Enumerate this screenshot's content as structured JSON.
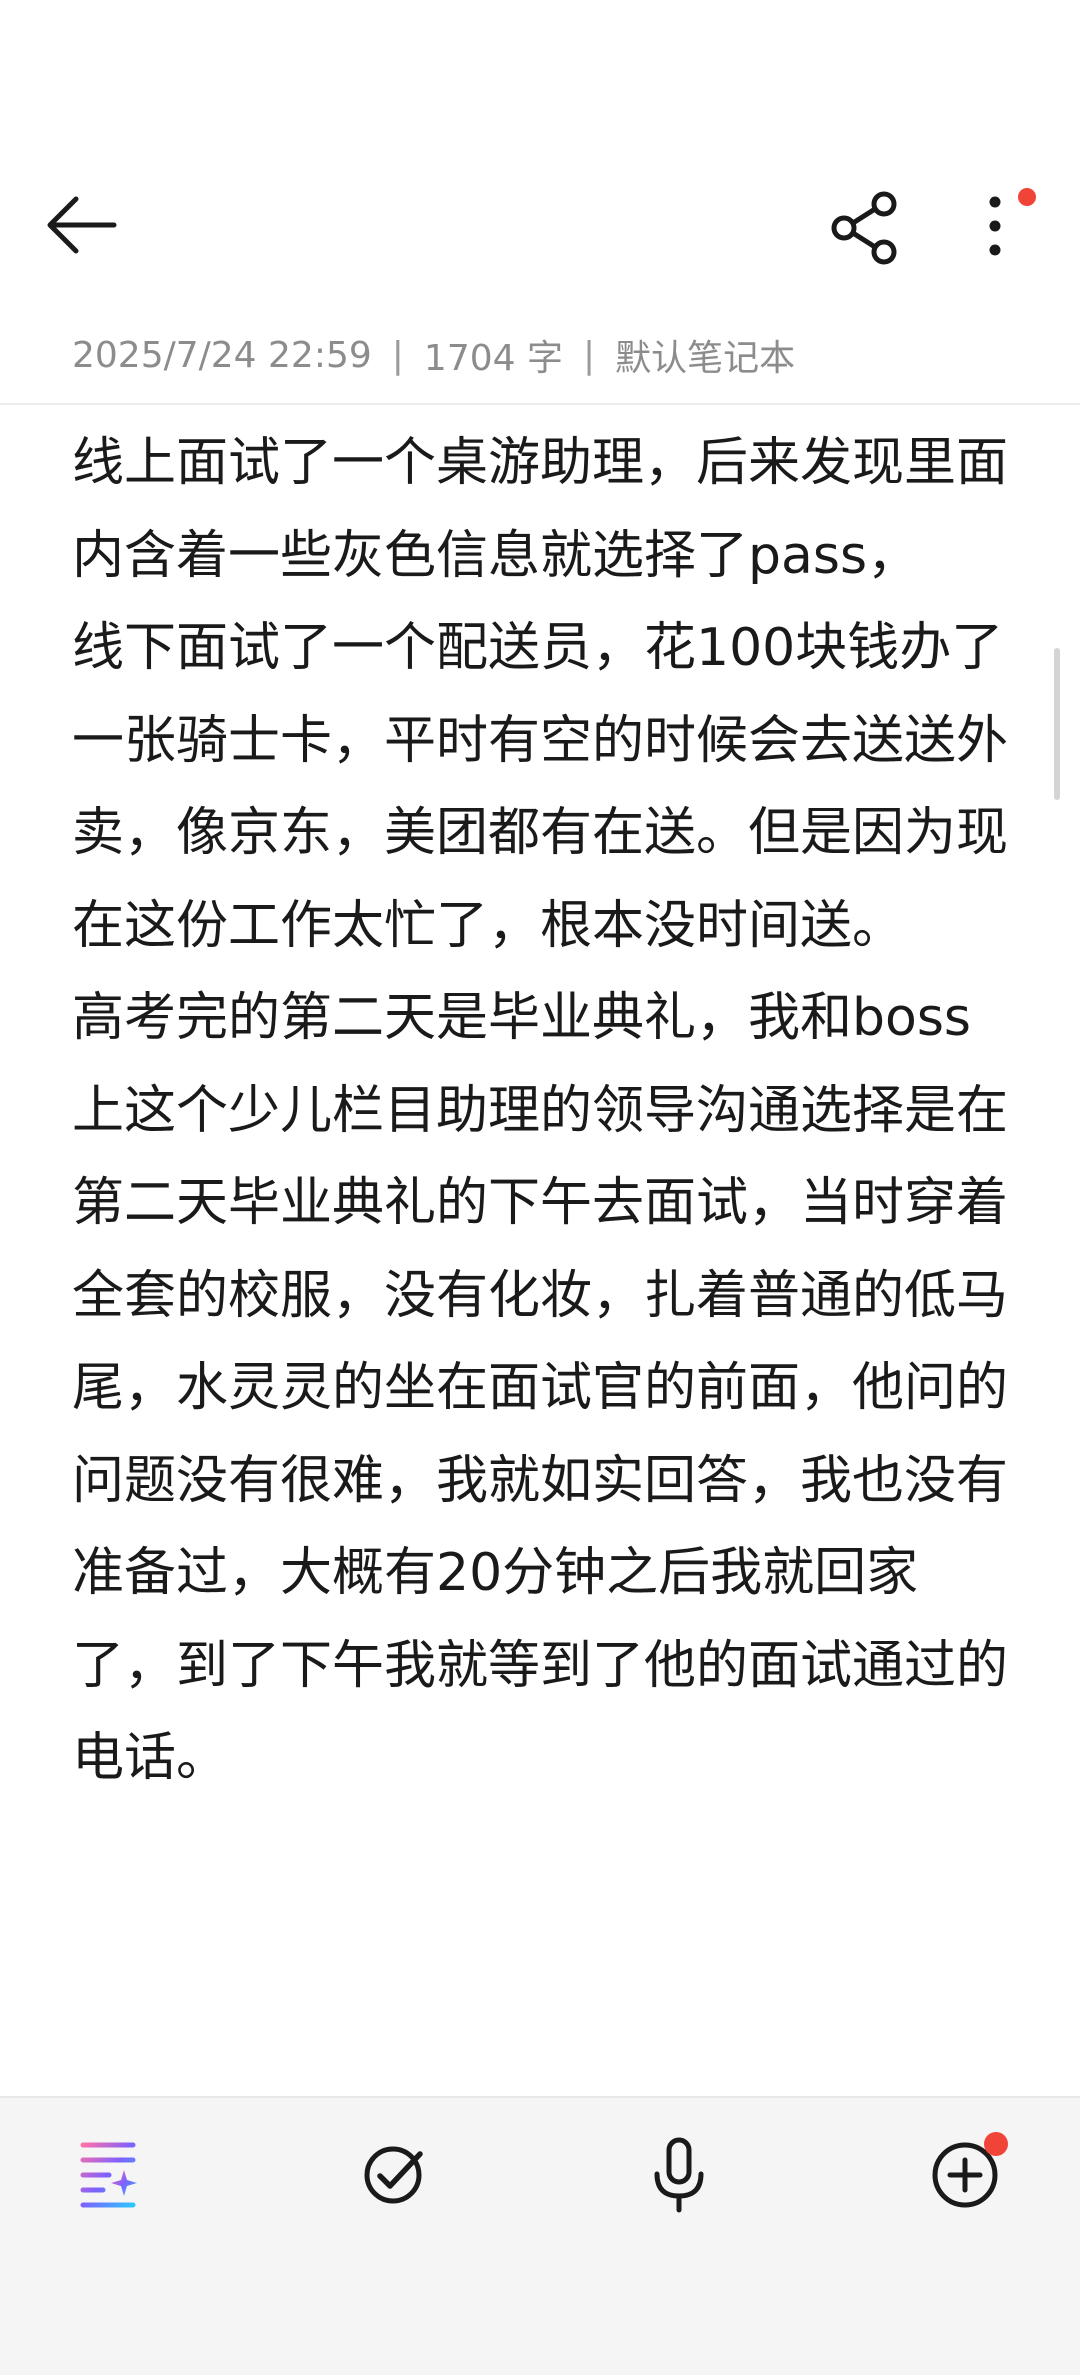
{
  "toolbar": {
    "back_icon": "arrow-left-icon",
    "share_icon": "share-icon",
    "more_icon": "more-vertical-icon",
    "notification_dot_color": "#f04438"
  },
  "meta": {
    "datetime": "2025/7/24 22:59",
    "separator": "|",
    "word_count": "1704 字",
    "notebook": "默认笔记本"
  },
  "note": {
    "content": "线上面试了一个桌游助理，后来发现里面内含着一些灰色信息就选择了pass，\n线下面试了一个配送员，花100块钱办了一张骑士卡，平时有空的时候会去送送外卖，像京东，美团都有在送。但是因为现在这份工作太忙了，根本没时间送。\n高考完的第二天是毕业典礼，我和boss上这个少儿栏目助理的领导沟通选择是在第二天毕业典礼的下午去面试，当时穿着全套的校服，没有化妆，扎着普通的低马尾，水灵灵的坐在面试官的前面，他问的问题没有很难，我就如实回答，我也没有准备过，大概有20分钟之后我就回家了，到了下午我就等到了他的面试通过的电话。"
  },
  "bottom_tools": {
    "ai_icon": "ai-format-icon",
    "todo_icon": "checklist-icon",
    "voice_icon": "microphone-icon",
    "add_icon": "add-circle-icon",
    "ai_gradient": [
      "#ff6fa8",
      "#7b61ff",
      "#2ec5ff"
    ]
  }
}
